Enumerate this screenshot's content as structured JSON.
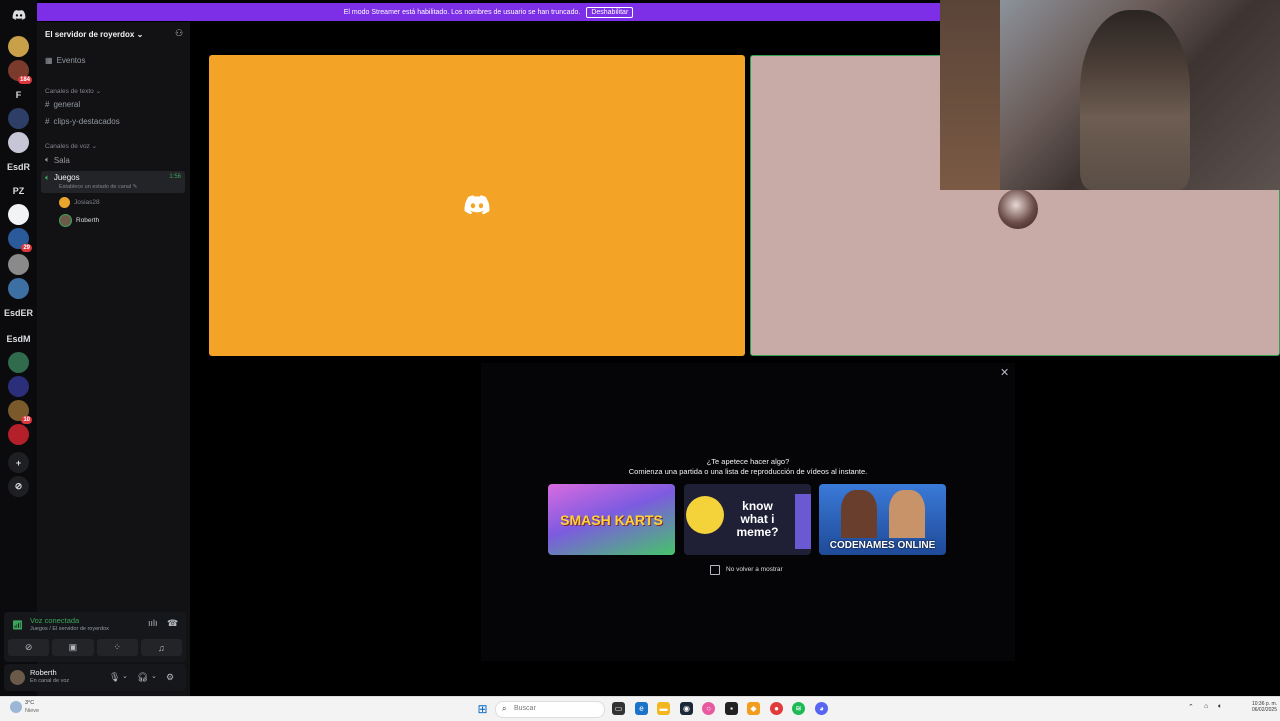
{
  "banner": {
    "text": "El modo Streamer está habilitado. Los nombres de usuario se han truncado.",
    "button": "Deshabilitar"
  },
  "rail": {
    "servers": [
      {
        "label": "",
        "color": "#c9a04a",
        "icon": "server-1"
      },
      {
        "label": "",
        "color": "#7a3a2c",
        "badge": "184",
        "icon": "server-2"
      },
      {
        "label": "F",
        "color": "#0b0b0d"
      },
      {
        "label": "",
        "color": "#2d3f66",
        "icon": "server-4"
      },
      {
        "label": "",
        "color": "#c6c6d6",
        "icon": "server-5"
      },
      {
        "label": "EsdR",
        "color": "#0b0b0d"
      },
      {
        "label": "PZ",
        "color": "#0b0b0d"
      },
      {
        "label": "",
        "color": "#f2f3f5",
        "icon": "server-8"
      },
      {
        "label": "",
        "color": "#2a5a9a",
        "badge": "29",
        "icon": "server-9"
      },
      {
        "label": "",
        "color": "#8a8a8a",
        "icon": "server-10"
      },
      {
        "label": "",
        "color": "#3d6fa3",
        "icon": "server-11"
      },
      {
        "label": "EsdER",
        "color": "#0b0b0d"
      },
      {
        "label": "EsdM",
        "color": "#0b0b0d"
      },
      {
        "label": "",
        "color": "#2f6b4c",
        "icon": "server-14"
      },
      {
        "label": "",
        "color": "#2b2f7a",
        "icon": "server-15"
      },
      {
        "label": "",
        "color": "#7a5a2a",
        "badge": "10",
        "icon": "server-16"
      },
      {
        "label": "",
        "color": "#b3202a",
        "icon": "server-17"
      }
    ]
  },
  "sidebar": {
    "server_name": "El servidor de royerdox",
    "events": "Eventos",
    "text_category": "Canales de texto",
    "text_channels": [
      "general",
      "clips-y-destacados"
    ],
    "voice_category": "Canales de voz",
    "voice_channels": [
      "Sala",
      "Juegos"
    ],
    "active_voice": {
      "name": "Juegos",
      "timer": "1:56",
      "status_hint": "Establece un estado de canal",
      "users": [
        "Josias28",
        "Roberth"
      ]
    }
  },
  "voice_panel": {
    "title": "Voz conectada",
    "subtitle": "Juegos / El servidor de royerdox"
  },
  "user_panel": {
    "name": "Roberth",
    "status": "En canal de voz"
  },
  "activity": {
    "title": "¿Te apetece hacer algo?",
    "subtitle": "Comienza una partida o una lista de reproducción de vídeos al instante.",
    "cards": [
      {
        "label": "SMASH KARTS",
        "color": "#8a5bd8"
      },
      {
        "label": "know what i meme?",
        "color": "#1f1f36"
      },
      {
        "label": "CODENAMES ONLINE",
        "color": "#2a5ea8"
      }
    ],
    "checkbox_label": "No volver a mostrar"
  },
  "taskbar": {
    "weather_temp": "3°C",
    "weather_desc": "Nieve",
    "search_placeholder": "Buscar",
    "time": "10:36 p. m.",
    "date": "06/02/2025"
  }
}
